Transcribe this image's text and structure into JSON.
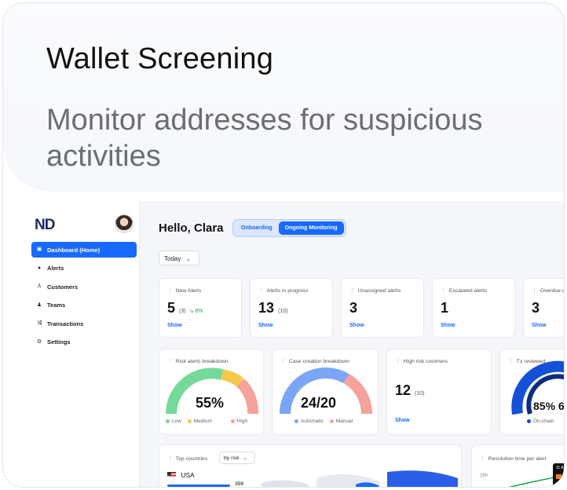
{
  "header": {
    "title": "Wallet Screening",
    "subtitle": "Monitor addresses for suspicious activities"
  },
  "sidebar": {
    "logo": "ND",
    "items": [
      {
        "label": "Dashboard (Home)",
        "icon": "dashboard-icon",
        "active": true
      },
      {
        "label": "Alerts",
        "icon": "alert-icon"
      },
      {
        "label": "Customers",
        "icon": "user-icon"
      },
      {
        "label": "Teams",
        "icon": "team-icon"
      },
      {
        "label": "Transactions",
        "icon": "shuffle-icon"
      },
      {
        "label": "Settings",
        "icon": "gear-icon"
      }
    ]
  },
  "main": {
    "greeting": "Hello, Clara",
    "tabs": [
      {
        "label": "Onboarding"
      },
      {
        "label": "Ongoing Monitoring",
        "active": true
      }
    ],
    "date_filter": "Today",
    "stats": [
      {
        "label": "New Alerts",
        "value": "5",
        "sub": "(3)",
        "trend": "↘ 8%",
        "action": "Show"
      },
      {
        "label": "Alerts in progress",
        "value": "13",
        "sub": "(10)",
        "action": "Show"
      },
      {
        "label": "Unassigned alerts",
        "value": "3",
        "action": "Show"
      },
      {
        "label": "Escalated alerts",
        "value": "1",
        "action": "Show"
      },
      {
        "label": "Overdue c",
        "value": "3",
        "action": "Show"
      }
    ],
    "risk_breakdown": {
      "label": "Risk alerts breakdown",
      "value": "55%",
      "legend": [
        "Low",
        "Medium",
        "High"
      ],
      "colors": {
        "low": "#74d99a",
        "medium": "#f7c94a",
        "high": "#f6a19a"
      }
    },
    "case_creation": {
      "label": "Case creation breakdown",
      "value": "24/20",
      "legend": [
        "Automatic",
        "Manual"
      ],
      "colors": {
        "automatic": "#7aa6f7",
        "manual": "#f6a19a"
      }
    },
    "high_risk": {
      "label": "High risk cutomers",
      "value": "12",
      "sub": "(10)",
      "action": "Show"
    },
    "tx_reviewed": {
      "label": "Tx reviewed",
      "value": "85% 6",
      "legend": [
        "On-chain"
      ],
      "colors": {
        "onchain": "#1450d8"
      }
    },
    "top_countries": {
      "label": "Top countries",
      "filter": "by risk",
      "country": "USA",
      "count": "398"
    },
    "resolution": {
      "label": "Resolution time per alert",
      "tick": "28h",
      "tooltip": "11 A"
    }
  }
}
